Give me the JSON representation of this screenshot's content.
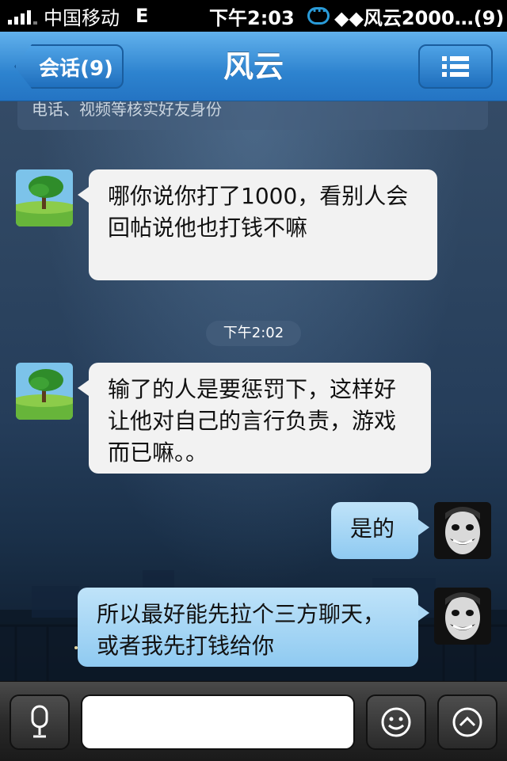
{
  "status_bar": {
    "carrier": "中国移动",
    "network": "E",
    "time": "下午2:03",
    "notification": "◆◆风云2000…(9)"
  },
  "nav": {
    "back_label": "会话(9)",
    "title": "风云",
    "menu_icon": "list-icon"
  },
  "chat": {
    "notice": "电话、视频等核实好友身份",
    "time_divider": "下午2:02",
    "messages": [
      {
        "side": "left",
        "avatar": "tree-avatar",
        "text": "哪你说你打了1000，看别人会回帖说他也打钱不嘛"
      },
      {
        "side": "left",
        "avatar": "tree-avatar",
        "text": "输了的人是要惩罚下，这样好让他对自己的言行负责，游戏而已嘛。。"
      },
      {
        "side": "right",
        "avatar": "joker-avatar",
        "text": "是的"
      },
      {
        "side": "right",
        "avatar": "joker-avatar",
        "text": "所以最好能先拉个三方聊天，或者我先打钱给你"
      }
    ]
  },
  "input_bar": {
    "voice_icon": "microphone-icon",
    "input_value": "",
    "emoji_icon": "smiley-icon",
    "more_icon": "expand-up-icon"
  },
  "colors": {
    "nav_blue": "#2d83cf",
    "incoming_bubble": "#f2f2f2",
    "outgoing_bubble": "#9fd1f3",
    "status_bar": "#000000"
  }
}
